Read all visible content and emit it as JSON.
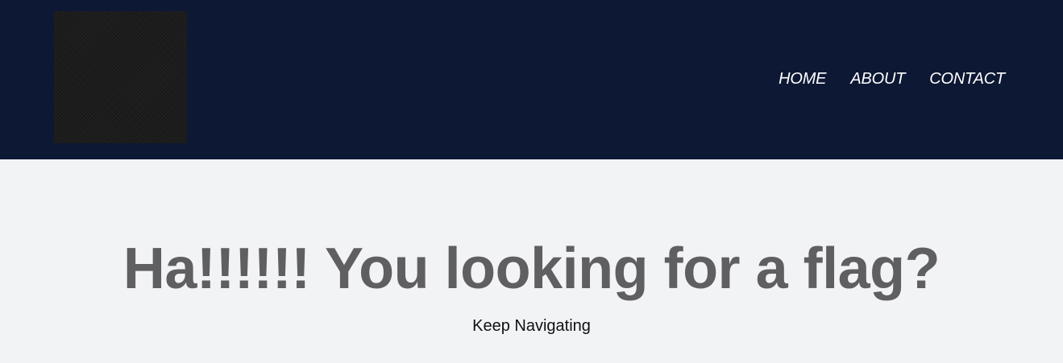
{
  "nav": {
    "items": [
      {
        "label": "HOME"
      },
      {
        "label": "ABOUT"
      },
      {
        "label": "CONTACT"
      }
    ]
  },
  "main": {
    "heading": "Ha!!!!!! You looking for a flag?",
    "subtext": "Keep Navigating"
  },
  "colors": {
    "header_bg": "#0d1834",
    "page_bg": "#f2f3f5",
    "heading": "#5f5e60",
    "nav_text": "#ffffff"
  }
}
